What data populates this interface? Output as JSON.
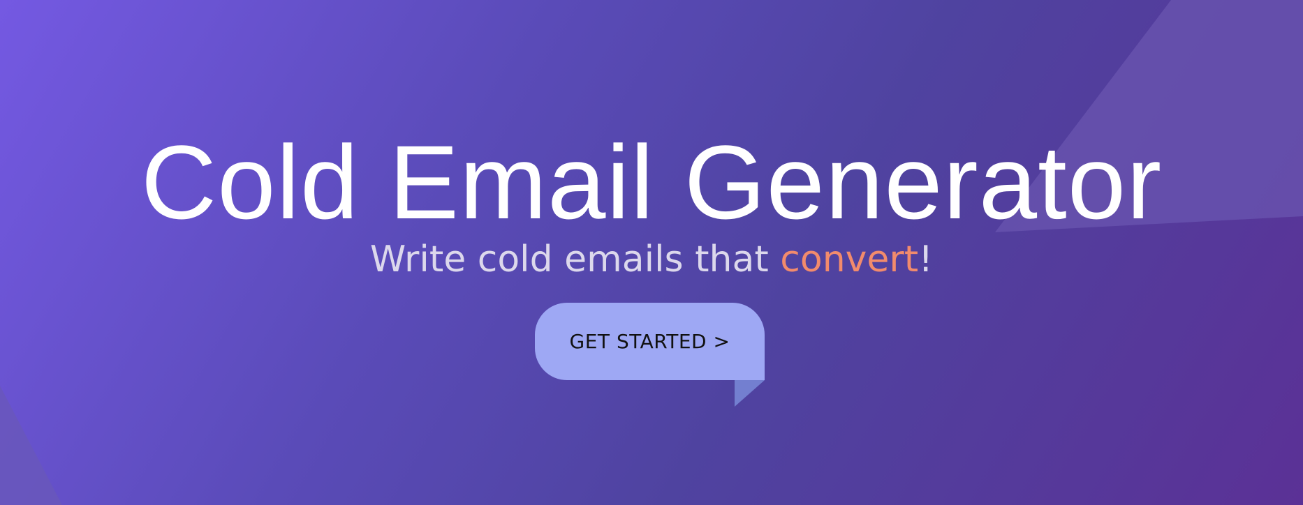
{
  "hero": {
    "title": "Cold Email Generator",
    "subtitle_prefix": "Write cold emails that ",
    "subtitle_accent": "convert",
    "subtitle_suffix": "!",
    "cta_label": "GET STARTED >"
  },
  "colors": {
    "accent": "#f28b6c",
    "button": "#9ea8f4",
    "background": "#5046a0"
  }
}
